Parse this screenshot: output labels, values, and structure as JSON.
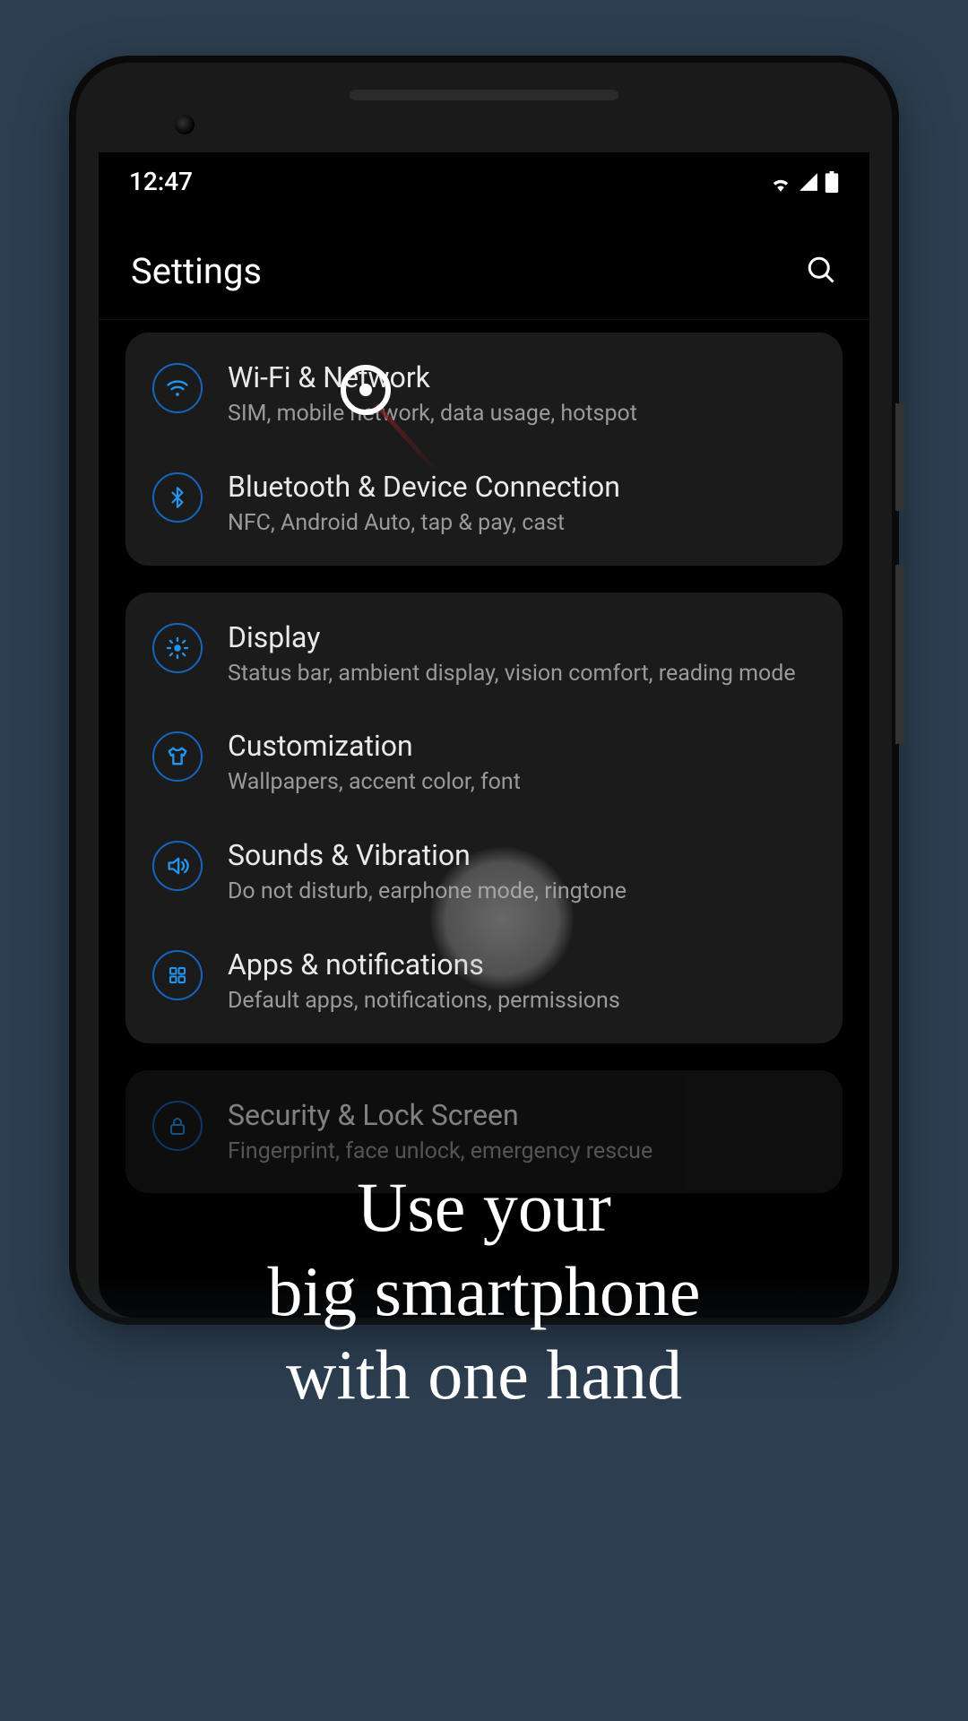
{
  "status": {
    "time": "12:47"
  },
  "header": {
    "title": "Settings"
  },
  "groups": [
    {
      "items": [
        {
          "icon": "wifi",
          "title": "Wi-Fi & Network",
          "sub": "SIM, mobile network, data usage, hotspot"
        },
        {
          "icon": "bluetooth",
          "title": "Bluetooth & Device Connection",
          "sub": "NFC, Android Auto, tap & pay, cast"
        }
      ]
    },
    {
      "items": [
        {
          "icon": "display",
          "title": "Display",
          "sub": "Status bar, ambient display, vision comfort, reading mode"
        },
        {
          "icon": "customization",
          "title": "Customization",
          "sub": "Wallpapers, accent color, font"
        },
        {
          "icon": "sound",
          "title": "Sounds & Vibration",
          "sub": "Do not disturb, earphone mode, ringtone"
        },
        {
          "icon": "apps",
          "title": "Apps & notifications",
          "sub": "Default apps, notifications, permissions"
        }
      ]
    },
    {
      "items": [
        {
          "icon": "security",
          "title": "Security & Lock Screen",
          "sub": "Fingerprint, face unlock, emergency rescue"
        }
      ]
    }
  ],
  "caption": {
    "line1": "Use your",
    "line2": "big smartphone",
    "line3": "with one hand"
  },
  "colors": {
    "accent": "#2196f3"
  }
}
